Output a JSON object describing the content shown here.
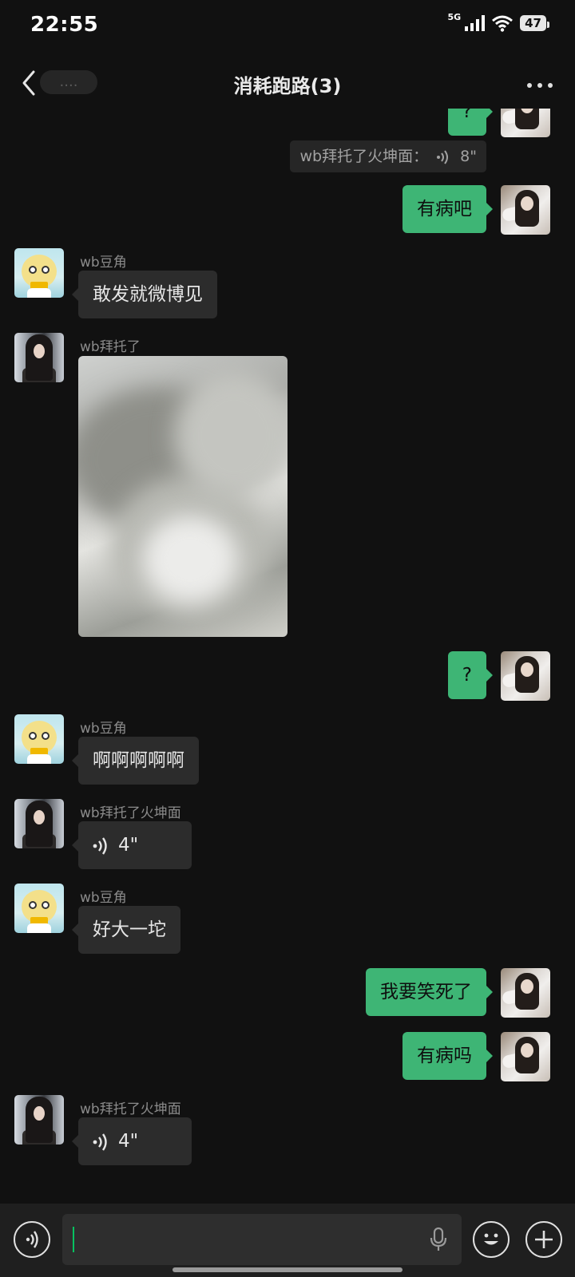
{
  "status_bar": {
    "time": "22:55",
    "network": "5G",
    "battery": "47"
  },
  "nav": {
    "back_name": "....",
    "title": "消耗跑路(3)"
  },
  "messages": {
    "m0": {
      "text": "?"
    },
    "quote": {
      "text": "wb拜托了火坤面：",
      "duration": "8\""
    },
    "m1": {
      "text": "有病吧"
    },
    "m2": {
      "sender": "wb豆角",
      "text": "敢发就微博见"
    },
    "m3": {
      "sender": "wb拜托了"
    },
    "m4": {
      "text": "?"
    },
    "m5": {
      "sender": "wb豆角",
      "text": "啊啊啊啊啊"
    },
    "m6": {
      "sender": "wb拜托了火坤面",
      "duration": "4\""
    },
    "m7": {
      "sender": "wb豆角",
      "text": "好大一坨"
    },
    "m8": {
      "text": "我要笑死了"
    },
    "m9": {
      "text": "有病吗"
    },
    "m10": {
      "sender": "wb拜托了火坤面",
      "duration": "4\""
    }
  },
  "colors": {
    "accent": "#3eb575",
    "background": "#111111",
    "bubble_in": "#2c2c2c"
  },
  "icons": [
    "back-chevron-icon",
    "more-icon",
    "voice-toggle-icon",
    "mic-icon",
    "emoji-icon",
    "plus-icon",
    "voice-wave-icon"
  ]
}
